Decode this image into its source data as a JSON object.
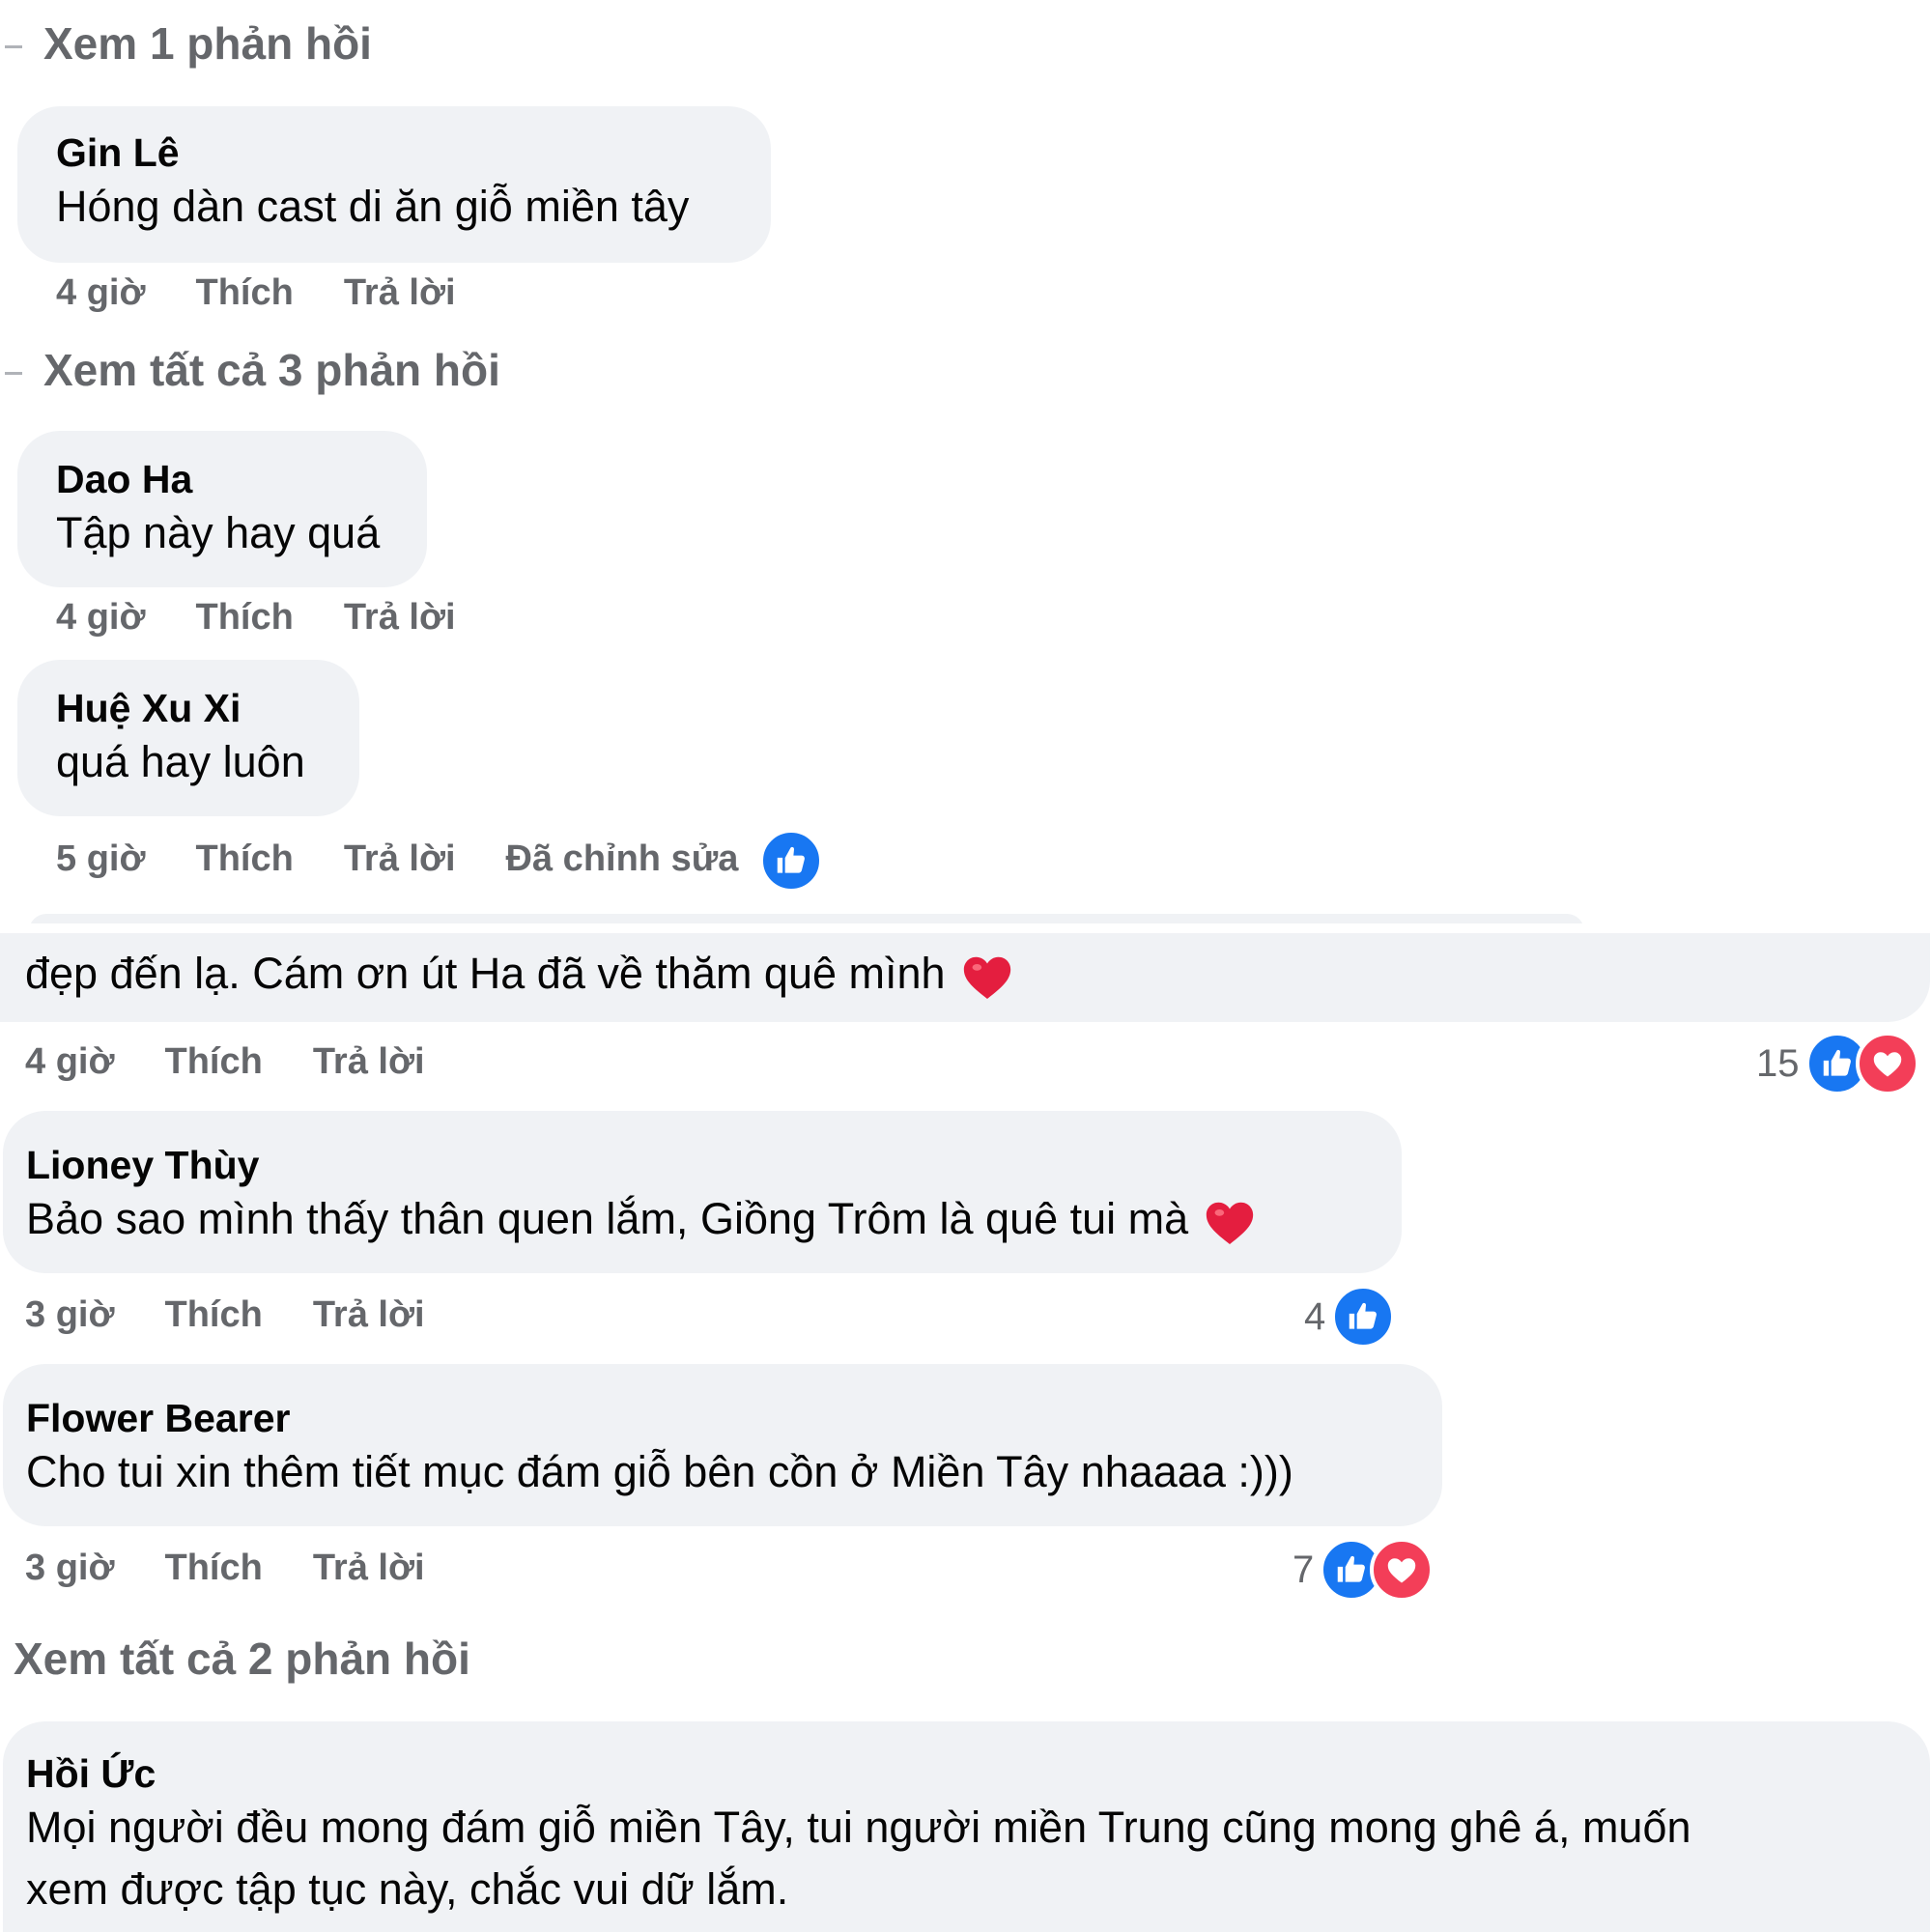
{
  "colors": {
    "bubble": "#f0f2f5",
    "meta": "#65676b",
    "like": "#1877f2",
    "love": "#f33e58",
    "heart": "#e41e3f"
  },
  "view_more_1": "Xem 1 phản hồi",
  "view_more_3": "Xem tất cả 3 phản hồi",
  "view_more_2": "Xem tất cả 2 phản hồi",
  "actions": {
    "like": "Thích",
    "reply": "Trả lời",
    "edited": "Đã chỉnh sửa"
  },
  "comments": [
    {
      "author": "Gin Lê",
      "text": "Hóng dàn cast di ăn giỗ miền tây",
      "time": "4 giờ"
    },
    {
      "author": "Dao Ha",
      "text": "Tập này hay quá",
      "time": "4 giờ"
    },
    {
      "author": "Huệ Xu Xi",
      "text": "quá hay luôn",
      "time": "5 giờ",
      "reactions": {
        "icons": [
          "like-icon"
        ]
      }
    },
    {
      "author": "",
      "text": "đẹp đến lạ. Cám ơn út Ha đã về thăm quê mình",
      "time": "4 giờ",
      "reactions": {
        "count": "15",
        "icons": [
          "like-icon",
          "love-icon"
        ]
      }
    },
    {
      "author": "Lioney Thùy",
      "text": "Bảo sao mình thấy thân quen lắm, Giồng Trôm là quê tui mà",
      "time": "3 giờ",
      "reactions": {
        "count": "4",
        "icons": [
          "like-icon"
        ]
      }
    },
    {
      "author": "Flower Bearer",
      "text": "Cho tui xin thêm tiết mục đám giỗ bên cồn ở Miền Tây nhaaaa :)))",
      "time": "3 giờ",
      "reactions": {
        "count": "7",
        "icons": [
          "like-icon",
          "love-icon"
        ]
      }
    },
    {
      "author": "Hồi Ức",
      "text_line1": "Mọi người đều mong đám giỗ miền Tây, tui người miền Trung cũng mong ghê á, muốn",
      "text_line2": "xem được tập tục này, chắc vui dữ lắm."
    }
  ]
}
